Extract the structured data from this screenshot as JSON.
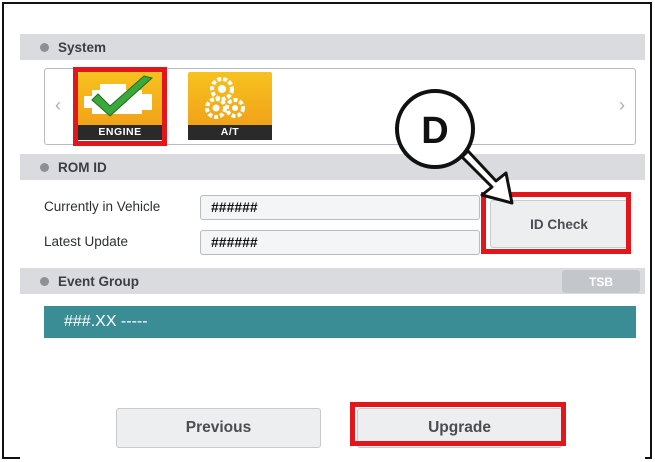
{
  "system": {
    "title": "System"
  },
  "modules": [
    {
      "label": "ENGINE",
      "icon": "engine-check-icon"
    },
    {
      "label": "A/T",
      "icon": "gears-icon"
    }
  ],
  "rom": {
    "title": "ROM ID",
    "current_label": "Currently in Vehicle",
    "current_value": "######",
    "latest_label": "Latest Update",
    "latest_value": "######",
    "id_check_label": "ID Check"
  },
  "event": {
    "title": "Event Group",
    "tsb_label": "TSB",
    "row": "###.XX -----"
  },
  "buttons": {
    "previous": "Previous",
    "upgrade": "Upgrade"
  },
  "callout": {
    "letter": "D"
  },
  "colors": {
    "highlight": "#e3161b",
    "event_row": "#3a8d94",
    "module": "#f4b21b"
  }
}
